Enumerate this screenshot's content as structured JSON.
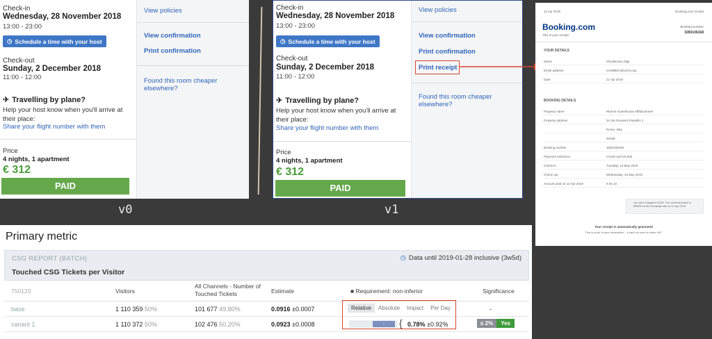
{
  "booking": {
    "checkin_label": "Check-in",
    "checkin_date": "Wednesday, 28 November 2018",
    "checkin_time": "13:00 - 23:00",
    "host_button": "Schedule a time with your host",
    "checkout_label": "Check-out",
    "checkout_date": "Sunday, 2 December 2018",
    "checkout_time": "11:00 - 12:00",
    "plane_title": "Travelling by plane?",
    "plane_text": "Help your host know when you'll arrive at their place:",
    "plane_link": "Share your flight number with them",
    "price_label": "Price",
    "price_sub": "4 nights, 1 apartment",
    "price_value": "€ 312",
    "paid": "PAID",
    "side": {
      "view_policies": "View policies",
      "view_confirmation": "View confirmation",
      "print_confirmation": "Print confirmation",
      "print_receipt": "Print receipt",
      "cheaper": "Found this room cheaper elsewhere?"
    }
  },
  "versions": {
    "v0": "v0",
    "v1": "v1"
  },
  "receipt": {
    "logo": "Booking.com",
    "logo_sub": "This is your receipt",
    "top_left": "11 Apr 2019",
    "top_right": "Booking.com receipt",
    "number_label": "Booking Number",
    "number": "3283106168",
    "your_details": "YOUR DETAILS",
    "details_rows": [
      {
        "k": "Name",
        "v": "Ghodsizava Zigit"
      },
      {
        "k": "Email address",
        "v": "ezz9885.5@ymes.top"
      },
      {
        "k": "Date",
        "v": "11 Apr 2019"
      }
    ],
    "booking_details": "BOOKING DETAILS",
    "booking_rows": [
      {
        "k": "Property name",
        "v": "Rhome Guesthouse Affittacamere"
      },
      {
        "k": "Property address",
        "v": "34 Via Giovanni Paisiello 1"
      },
      {
        "k": "",
        "v": "Rome, Italy"
      },
      {
        "k": "",
        "v": "00198"
      },
      {
        "k": "Booking number",
        "v": "3283106168"
      },
      {
        "k": "Payment reference",
        "v": "Credit card 94-002"
      },
      {
        "k": "Check-in",
        "v": "Tuesday, 14 May 2019"
      },
      {
        "k": "Check-out",
        "v": "Wednesday, 15 May 2019"
      },
      {
        "k": "Amount paid on 11 Apr 2019",
        "v": "€ 84.10"
      }
    ],
    "note": "You were charged in EUR. The converted price is €84800 at the exchange rate on 11 Apr 2019.",
    "footer1": "Your receipt is automatically generated",
    "footer2": "This is proof of your transaction – it can't be used to claim VAT."
  },
  "metric": {
    "title": "Primary metric",
    "report_label": "CSG REPORT (BATCH)",
    "data_until": "Data until 2019-01-28 inclusive (3w5d)",
    "touched": "Touched CSG Tickets per Visitor",
    "headers": {
      "id": "750120",
      "visitors": "Visitors",
      "channels": "All Channels - Number of Touched Tickets",
      "estimate": "Estimate",
      "requirement": "Requirement: non-inferior",
      "significance": "Significance"
    },
    "tabs": [
      "Relative",
      "Absolute",
      "Impact",
      "Per Day"
    ],
    "rows": [
      {
        "name": "base",
        "visitors": "1 110 359",
        "visitors_pct": "50%",
        "tickets": "101 677",
        "tickets_pct": "49.80%",
        "estimate": "0.0916",
        "estimate_err": "±0.0007",
        "significance": "-"
      },
      {
        "name": "variant 1",
        "visitors": "1 110 372",
        "visitors_pct": "50%",
        "tickets": "102 476",
        "tickets_pct": "50.20%",
        "estimate": "0.0923",
        "estimate_err": "±0.0008",
        "ci_marker": "-",
        "relative_change": "0.78%",
        "relative_err": "±0.92%",
        "sig_a": "≤ 2%",
        "sig_b": "Yes"
      }
    ]
  },
  "colors": {
    "link": "#2f64b9",
    "paid": "#65a84b",
    "price": "#4a9d3a",
    "highlight_red": "#d9432f",
    "booking_blue": "#003580",
    "yes_green": "#3f9a3a"
  }
}
